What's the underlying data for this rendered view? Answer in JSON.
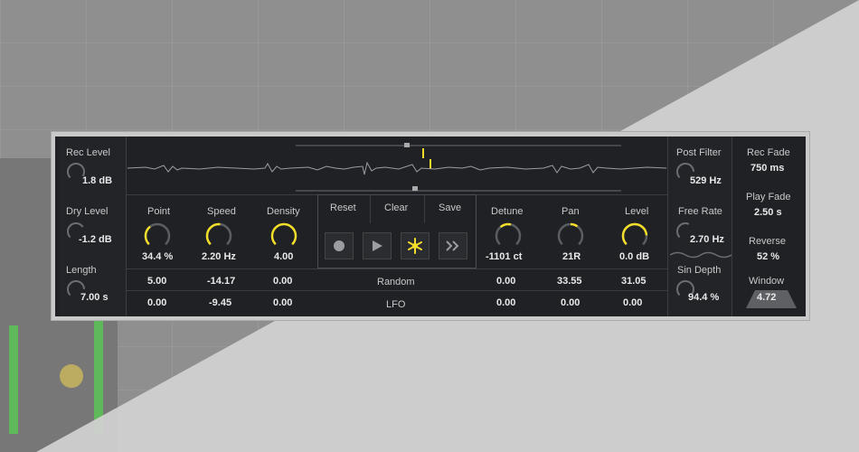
{
  "left": {
    "rec_level": {
      "label": "Rec Level",
      "value": "1.8 dB"
    },
    "dry_level": {
      "label": "Dry Level",
      "value": "-1.2 dB"
    },
    "length": {
      "label": "Length",
      "value": "7.00 s"
    }
  },
  "params": {
    "point": {
      "label": "Point",
      "value": "34.4 %",
      "random": "5.00",
      "lfo": "0.00"
    },
    "speed": {
      "label": "Speed",
      "value": "2.20 Hz",
      "random": "-14.17",
      "lfo": "-9.45"
    },
    "density": {
      "label": "Density",
      "value": "4.00",
      "random": "0.00",
      "lfo": "0.00"
    },
    "detune": {
      "label": "Detune",
      "value": "-1101 ct",
      "random": "0.00",
      "lfo": "0.00"
    },
    "pan": {
      "label": "Pan",
      "value": "21R",
      "random": "33.55",
      "lfo": "0.00"
    },
    "level": {
      "label": "Level",
      "value": "0.0 dB",
      "random": "31.05",
      "lfo": "0.00"
    }
  },
  "center": {
    "reset": "Reset",
    "clear": "Clear",
    "save": "Save",
    "random": "Random",
    "lfo": "LFO"
  },
  "right1": {
    "post_filter": {
      "label": "Post Filter",
      "value": "529 Hz"
    },
    "free_rate": {
      "label": "Free Rate",
      "value": "2.70 Hz"
    },
    "sin_depth": {
      "label": "Sin Depth",
      "value": "94.4 %"
    }
  },
  "right2": {
    "rec_fade": {
      "label": "Rec Fade",
      "value": "750 ms"
    },
    "play_fade": {
      "label": "Play Fade",
      "value": "2.50 s"
    },
    "reverse": {
      "label": "Reverse",
      "value": "52 %"
    },
    "window": {
      "label": "Window",
      "value": "4.72"
    }
  },
  "colors": {
    "accent": "#f2dd2a",
    "panel": "#1f2124",
    "text": "#e9e9e9"
  }
}
